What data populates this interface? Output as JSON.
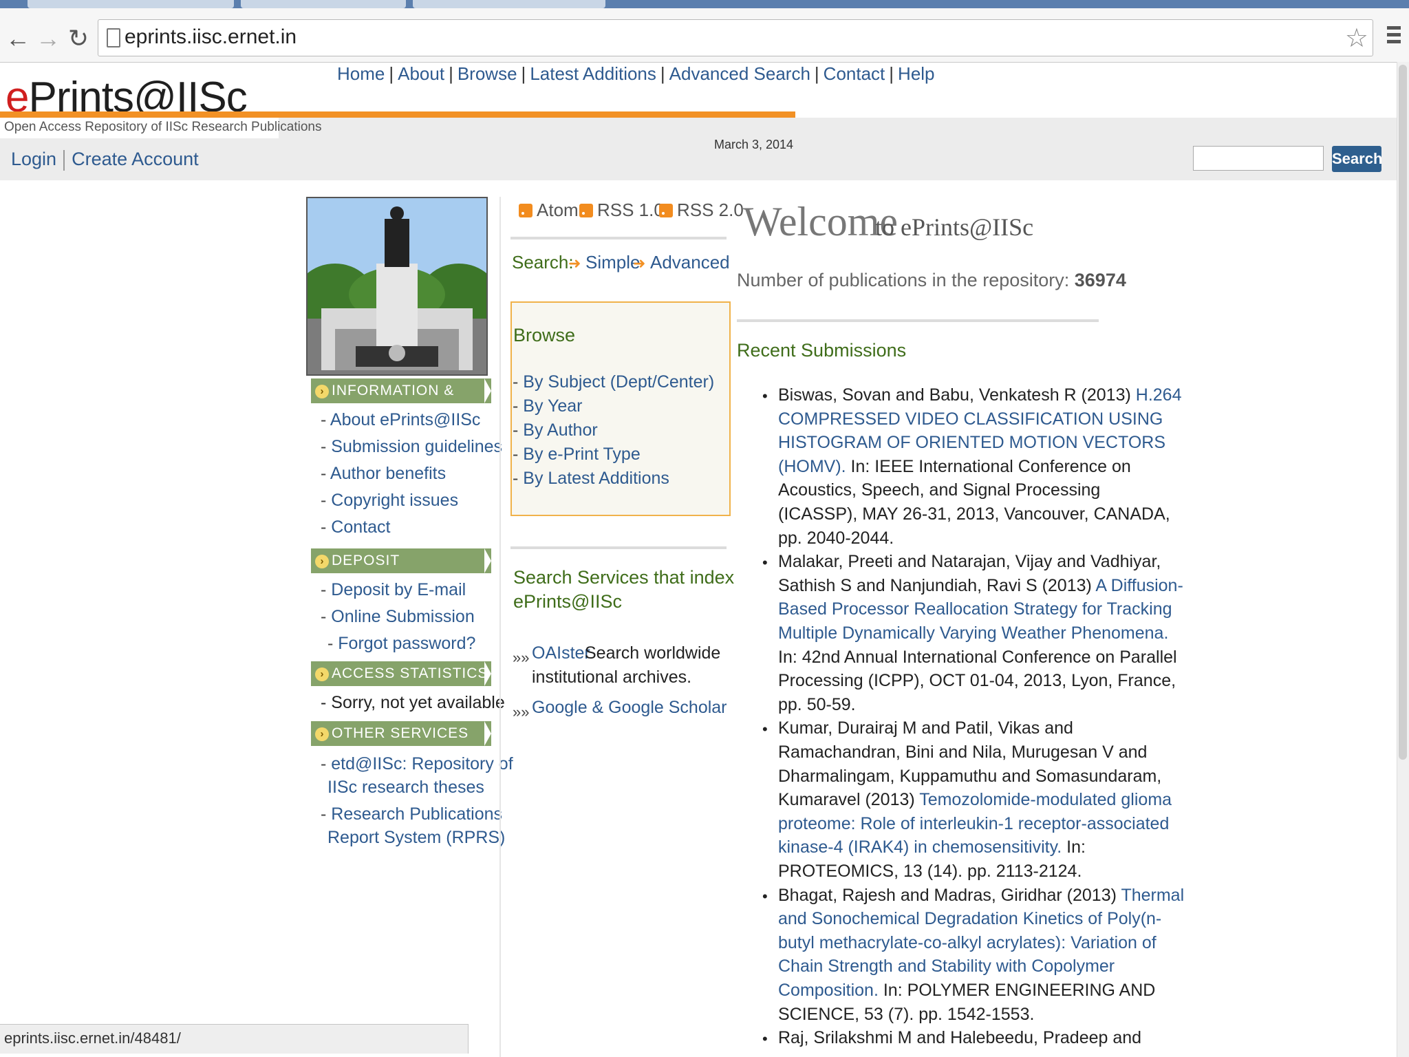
{
  "browser": {
    "url": "eprints.iisc.ernet.in",
    "status_url": "eprints.iisc.ernet.in/48481/"
  },
  "site": {
    "logo": "ePrints@IISc",
    "tagline": "Open Access Repository of IISc Research Publications",
    "date": "March 3, 2014",
    "nav": [
      "Home",
      "About",
      "Browse",
      "Latest Additions",
      "Advanced Search",
      "Contact",
      "Help"
    ],
    "login": "Login",
    "create_account": "Create Account",
    "search_button": "Search"
  },
  "left": {
    "info": {
      "title": "INFORMATION & HELP",
      "links": [
        "About ePrints@IISc",
        "Submission guidelines",
        "Author benefits",
        "Copyright issues",
        "Contact"
      ]
    },
    "deposit": {
      "title": "DEPOSIT PUBLICATIONS",
      "links": [
        "Deposit by E-mail",
        "Online Submission",
        "Forgot password?"
      ]
    },
    "stats": {
      "title": "ACCESS STATISTICS",
      "text": "Sorry, not yet available"
    },
    "other": {
      "title": "OTHER SERVICES",
      "links": [
        [
          "etd@IISc: Repository of",
          "IISc research theses"
        ],
        [
          "Research Publications",
          "Report System (RPRS)"
        ]
      ]
    }
  },
  "middle": {
    "feeds": [
      "Atom",
      "RSS 1.0",
      "RSS 2.0"
    ],
    "search_label": "Search:",
    "search_simple": "Simple",
    "search_advanced": "Advanced",
    "browse_title": "Browse",
    "browse_links": [
      "By Subject (Dept/Center)",
      "By Year",
      "By Author",
      "By e-Print Type",
      "By Latest Additions"
    ],
    "services_title": [
      "Search Services that index",
      "ePrints@IISc"
    ],
    "oaister_link": "OAIster",
    "oaister_text": [
      "Search worldwide",
      "institutional archives."
    ],
    "google_link": "Google & Google Scholar"
  },
  "right": {
    "welcome_big": "Welcome",
    "welcome_small": "to ePrints@IISc",
    "pub_label": "Number of publications in the repository:",
    "pub_count": "36974",
    "recent_title": "Recent Submissions",
    "entries": [
      [
        {
          "plain": "Biswas, Sovan and Babu, Venkatesh R (2013) ",
          "title": "H.264"
        },
        {
          "title": "COMPRESSED VIDEO CLASSIFICATION USING"
        },
        {
          "title": "HISTOGRAM OF ORIENTED MOTION VECTORS"
        },
        {
          "title": "(HOMV).",
          "plain_after": " In: IEEE International Conference on"
        },
        {
          "plain": "Acoustics, Speech, and Signal Processing"
        },
        {
          "plain": "(ICASSP), MAY 26-31, 2013, Vancouver, CANADA,"
        },
        {
          "plain": "pp. 2040-2044."
        }
      ],
      [
        {
          "plain": "Malakar, Preeti and Natarajan, Vijay and Vadhiyar,"
        },
        {
          "plain": "Sathish S and Nanjundiah, Ravi S (2013) ",
          "title": "A Diffusion-"
        },
        {
          "title": "Based Processor Reallocation Strategy for Tracking"
        },
        {
          "title": "Multiple Dynamically Varying Weather Phenomena."
        },
        {
          "plain": "In: 42nd Annual International Conference on Parallel"
        },
        {
          "plain": "Processing (ICPP), OCT 01-04, 2013, Lyon, France,"
        },
        {
          "plain": "pp. 50-59."
        }
      ],
      [
        {
          "plain": "Kumar, Durairaj M and Patil, Vikas and"
        },
        {
          "plain": "Ramachandran, Bini and Nila, Murugesan V and"
        },
        {
          "plain": "Dharmalingam, Kuppamuthu and Somasundaram,"
        },
        {
          "plain": "Kumaravel (2013) ",
          "title": "Temozolomide-modulated glioma"
        },
        {
          "title": "proteome: Role of interleukin-1 receptor-associated"
        },
        {
          "title": "kinase-4 (IRAK4) in chemosensitivity.",
          "plain_after": " In:"
        },
        {
          "plain": "PROTEOMICS, 13 (14). pp. 2113-2124."
        }
      ],
      [
        {
          "plain": "Bhagat, Rajesh and Madras, Giridhar (2013) ",
          "title": "Thermal"
        },
        {
          "title": "and Sonochemical Degradation Kinetics of Poly(n-"
        },
        {
          "title": "butyl methacrylate-co-alkyl acrylates): Variation of"
        },
        {
          "title": "Chain Strength and Stability with Copolymer"
        },
        {
          "title": "Composition.",
          "plain_after": " In: POLYMER ENGINEERING AND"
        },
        {
          "plain": "SCIENCE, 53 (7). pp. 1542-1553."
        }
      ],
      [
        {
          "plain": "Raj, Srilakshmi M and Halebeedu, Pradeep and"
        }
      ]
    ]
  },
  "colors": {
    "link": "#2e5a8f",
    "accent_orange": "#f29125",
    "section_green": "#86a36a",
    "heading_green": "#3f6d1a",
    "search_button": "#2e5f8e"
  }
}
